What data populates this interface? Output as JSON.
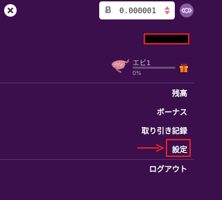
{
  "header": {
    "close_icon": "close-icon",
    "currency_symbol": "Ƀ",
    "balance": "0.000001",
    "avatar_icon": "avatar-icon"
  },
  "profile": {
    "rank_name": "エビ1",
    "progress_percent": 0,
    "progress_label": "0%",
    "rank_icon": "shrimp-icon",
    "reward_icon": "gift-icon"
  },
  "menu": {
    "balance_label": "残高",
    "bonus_label": "ボーナス",
    "transactions_label": "取り引き記録",
    "settings_label": "設定",
    "logout_label": "ログアウト"
  },
  "colors": {
    "background": "#3a0f4b",
    "highlight": "#e8202a",
    "divider": "#5f2f73"
  }
}
